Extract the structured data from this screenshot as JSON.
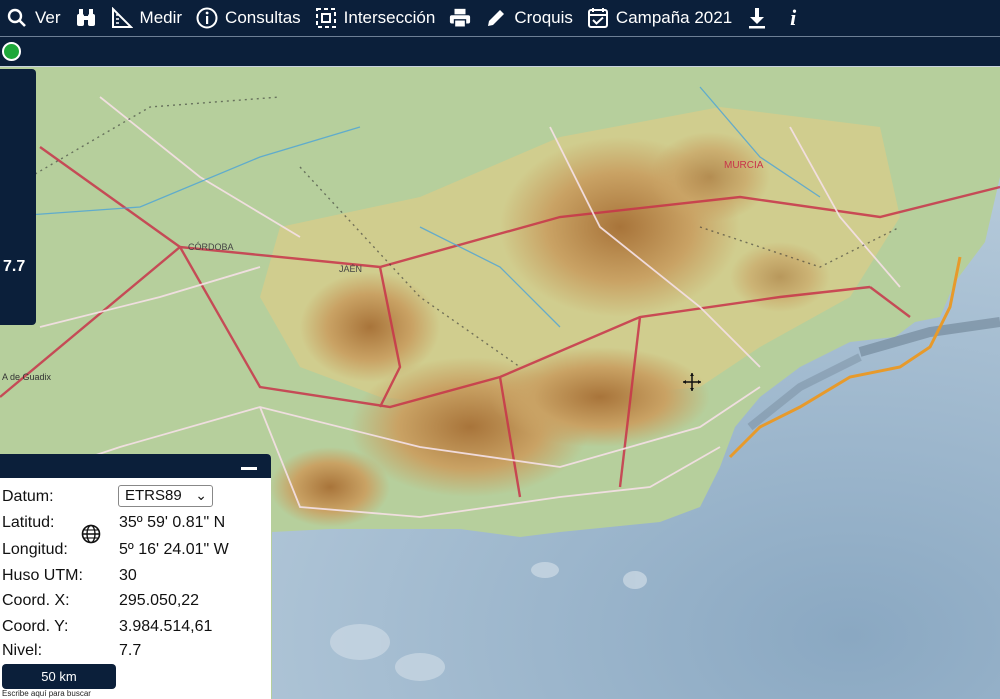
{
  "toolbar": {
    "items": [
      {
        "label": "Ver",
        "icon": "search-icon"
      },
      {
        "label": "",
        "icon": "binoculars-icon"
      },
      {
        "label": "Medir",
        "icon": "ruler-icon"
      },
      {
        "label": "Consultas",
        "icon": "info-icon"
      },
      {
        "label": "Intersección",
        "icon": "intersection-icon"
      },
      {
        "label": "",
        "icon": "printer-icon"
      },
      {
        "label": "Croquis",
        "icon": "pencil-icon"
      },
      {
        "label": "Campaña 2021",
        "icon": "calendar-check-icon"
      },
      {
        "label": "",
        "icon": "download-icon"
      },
      {
        "label": "",
        "icon": "italic-info-icon"
      }
    ]
  },
  "zoom": {
    "level": "7.7"
  },
  "map_labels": {
    "cordoba": "CÓRDOBA",
    "jaen": "JAÉN",
    "murcia": "MURCIA",
    "dehesas": "A de Guadix"
  },
  "info": {
    "datum_label": "Datum:",
    "datum_value": "ETRS89",
    "lat_label": "Latitud:",
    "lat_value": "35º 59' 0.81\" N",
    "lon_label": "Longitud:",
    "lon_value": "5º 16' 24.01\" W",
    "huso_label": "Huso UTM:",
    "huso_value": "30",
    "x_label": "Coord. X:",
    "x_value": "295.050,22",
    "y_label": "Coord. Y:",
    "y_value": "3.984.514,61",
    "nivel_label": "Nivel:",
    "nivel_value": "7.7"
  },
  "scale": {
    "label": "50 km"
  },
  "search_hint": "Escribe aquí para buscar",
  "colors": {
    "bar": "#0b1f3a",
    "status": "#1fa83a",
    "sea": "#9fb7c9",
    "land": "#b9d4a3"
  }
}
